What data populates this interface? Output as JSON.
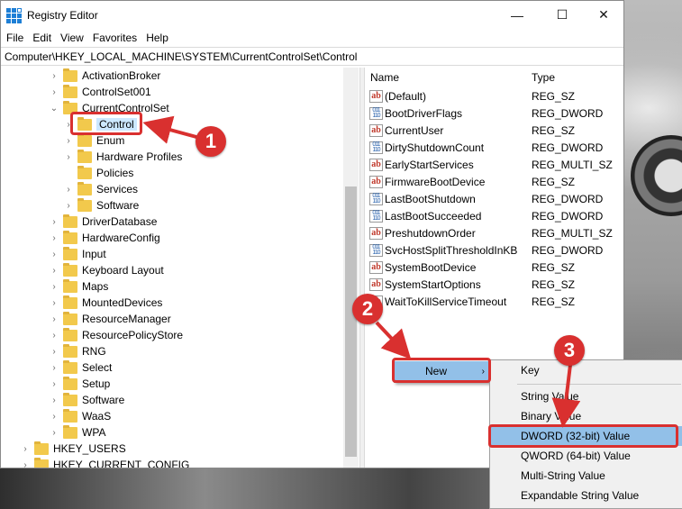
{
  "window": {
    "title": "Registry Editor",
    "minimize_icon": "—",
    "maximize_icon": "☐",
    "close_icon": "✕"
  },
  "menu": [
    "File",
    "Edit",
    "View",
    "Favorites",
    "Help"
  ],
  "address": "Computer\\HKEY_LOCAL_MACHINE\\SYSTEM\\CurrentControlSet\\Control",
  "tree": [
    {
      "label": "ActivationBroker",
      "expander": "›"
    },
    {
      "label": "ControlSet001",
      "expander": "›"
    },
    {
      "label": "CurrentControlSet",
      "expander": "⌄"
    },
    {
      "label": "Control",
      "expander": "›",
      "selected": true
    },
    {
      "label": "Enum",
      "expander": "›"
    },
    {
      "label": "Hardware Profiles",
      "expander": "›"
    },
    {
      "label": "Policies",
      "expander": ""
    },
    {
      "label": "Services",
      "expander": "›"
    },
    {
      "label": "Software",
      "expander": "›"
    },
    {
      "label": "DriverDatabase",
      "expander": "›"
    },
    {
      "label": "HardwareConfig",
      "expander": "›"
    },
    {
      "label": "Input",
      "expander": "›"
    },
    {
      "label": "Keyboard Layout",
      "expander": "›"
    },
    {
      "label": "Maps",
      "expander": "›"
    },
    {
      "label": "MountedDevices",
      "expander": "›"
    },
    {
      "label": "ResourceManager",
      "expander": "›"
    },
    {
      "label": "ResourcePolicyStore",
      "expander": "›"
    },
    {
      "label": "RNG",
      "expander": "›"
    },
    {
      "label": "Select",
      "expander": "›"
    },
    {
      "label": "Setup",
      "expander": "›"
    },
    {
      "label": "Software",
      "expander": "›"
    },
    {
      "label": "WaaS",
      "expander": "›"
    },
    {
      "label": "WPA",
      "expander": "›"
    },
    {
      "label": "HKEY_USERS",
      "expander": "›"
    },
    {
      "label": "HKEY_CURRENT_CONFIG",
      "expander": "›"
    }
  ],
  "list": {
    "headers": {
      "name": "Name",
      "type": "Type"
    },
    "rows": [
      {
        "name": "(Default)",
        "type": "REG_SZ",
        "icon": "ab"
      },
      {
        "name": "BootDriverFlags",
        "type": "REG_DWORD",
        "icon": "bin"
      },
      {
        "name": "CurrentUser",
        "type": "REG_SZ",
        "icon": "ab"
      },
      {
        "name": "DirtyShutdownCount",
        "type": "REG_DWORD",
        "icon": "bin"
      },
      {
        "name": "EarlyStartServices",
        "type": "REG_MULTI_SZ",
        "icon": "ab"
      },
      {
        "name": "FirmwareBootDevice",
        "type": "REG_SZ",
        "icon": "ab"
      },
      {
        "name": "LastBootShutdown",
        "type": "REG_DWORD",
        "icon": "bin"
      },
      {
        "name": "LastBootSucceeded",
        "type": "REG_DWORD",
        "icon": "bin"
      },
      {
        "name": "PreshutdownOrder",
        "type": "REG_MULTI_SZ",
        "icon": "ab"
      },
      {
        "name": "SvcHostSplitThresholdInKB",
        "type": "REG_DWORD",
        "icon": "bin"
      },
      {
        "name": "SystemBootDevice",
        "type": "REG_SZ",
        "icon": "ab"
      },
      {
        "name": "SystemStartOptions",
        "type": "REG_SZ",
        "icon": "ab"
      },
      {
        "name": "WaitToKillServiceTimeout",
        "type": "REG_SZ",
        "icon": "ab"
      }
    ]
  },
  "context_menu": {
    "new_label": "New",
    "submenu_arrow": "›"
  },
  "submenu": [
    "Key",
    "String Value",
    "Binary Value",
    "DWORD (32-bit) Value",
    "QWORD (64-bit) Value",
    "Multi-String Value",
    "Expandable String Value"
  ],
  "callouts": [
    "1",
    "2",
    "3"
  ],
  "colors": {
    "highlight": "#d9302f",
    "selection": "#cce8ff",
    "menu_highlight": "#92c0e8"
  }
}
